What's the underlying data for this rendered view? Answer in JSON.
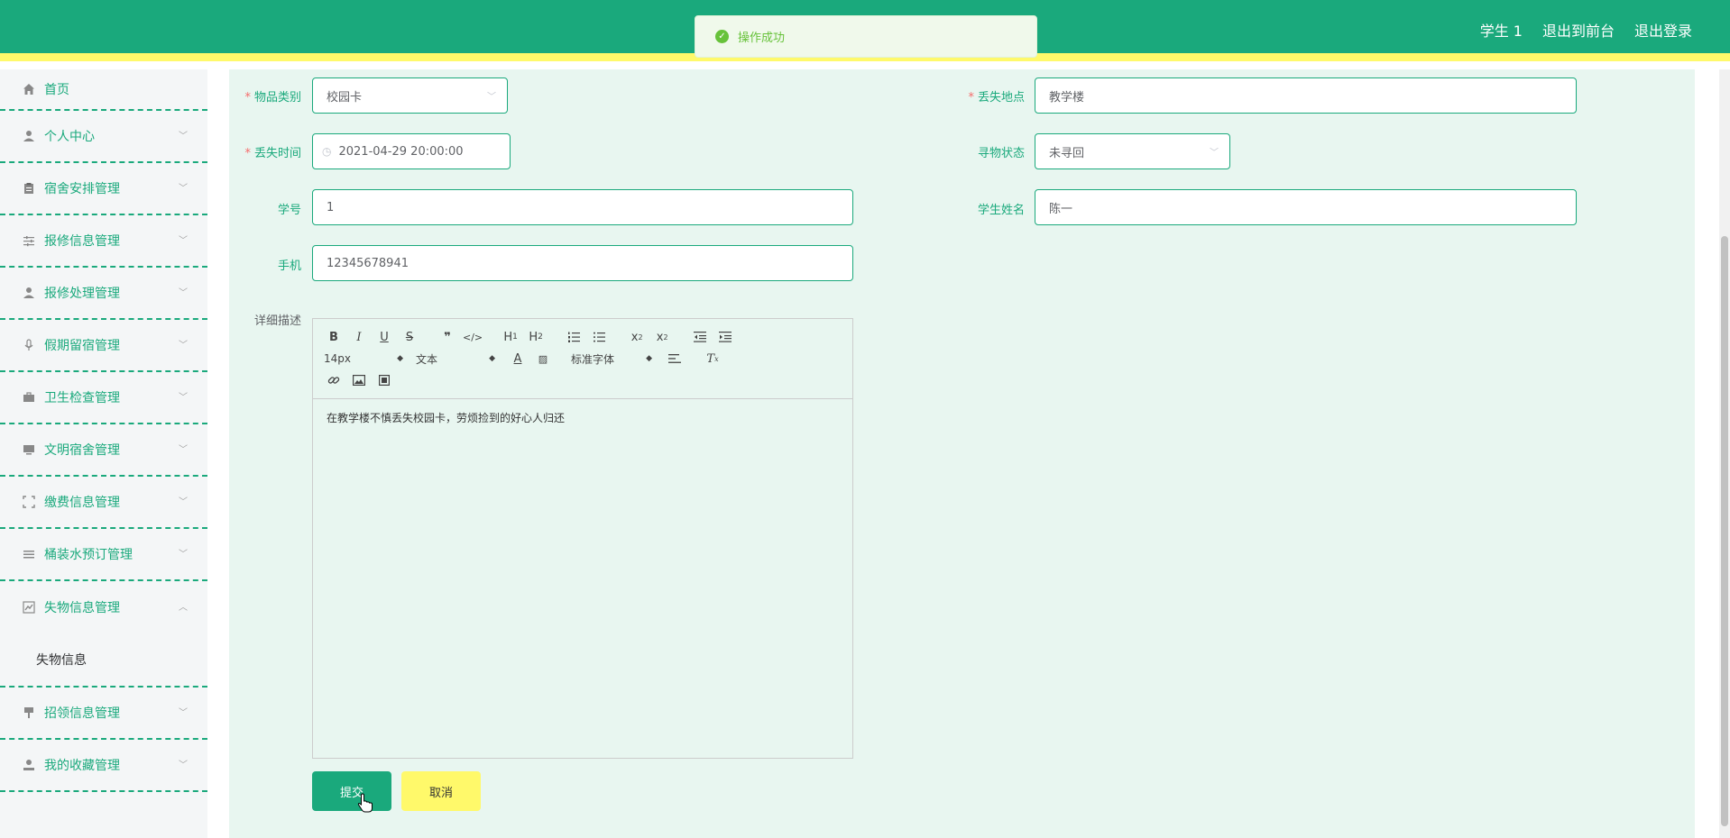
{
  "header": {
    "links": [
      "学生 1",
      "退出到前台",
      "退出登录"
    ]
  },
  "toast": {
    "message": "操作成功"
  },
  "sidebar": {
    "items": [
      {
        "label": "首页",
        "icon": "home-icon"
      },
      {
        "label": "个人中心",
        "icon": "user-icon"
      },
      {
        "label": "宿舍安排管理",
        "icon": "clipboard-icon"
      },
      {
        "label": "报修信息管理",
        "icon": "sliders-icon"
      },
      {
        "label": "报修处理管理",
        "icon": "user-icon"
      },
      {
        "label": "假期留宿管理",
        "icon": "microphone-icon"
      },
      {
        "label": "卫生检查管理",
        "icon": "briefcase-icon"
      },
      {
        "label": "文明宿舍管理",
        "icon": "monitor-icon"
      },
      {
        "label": "缴费信息管理",
        "icon": "fullscreen-icon"
      },
      {
        "label": "桶装水预订管理",
        "icon": "list-icon"
      },
      {
        "label": "失物信息管理",
        "icon": "chart-icon"
      },
      {
        "label": "招领信息管理",
        "icon": "paintbrush-icon"
      },
      {
        "label": "我的收藏管理",
        "icon": "user-star-icon"
      }
    ],
    "submenu": "失物信息"
  },
  "form": {
    "category_label": "物品类别",
    "category_value": "校园卡",
    "location_label": "丢失地点",
    "location_value": "教学楼",
    "time_label": "丢失时间",
    "time_value": "2021-04-29 20:00:00",
    "status_label": "寻物状态",
    "status_value": "未寻回",
    "student_no_label": "学号",
    "student_no_value": "1",
    "student_name_label": "学生姓名",
    "student_name_value": "陈一",
    "phone_label": "手机",
    "phone_value": "12345678941",
    "desc_label": "详细描述"
  },
  "editor": {
    "size": "14px",
    "format": "文本",
    "font": "标准字体",
    "content": "在教学楼不慎丢失校园卡，劳烦捡到的好心人归还"
  },
  "buttons": {
    "submit": "提交",
    "cancel": "取消"
  },
  "colors": {
    "primary": "#1aa97c",
    "accent": "#fff96a",
    "main_bg": "#e8f6f0"
  }
}
